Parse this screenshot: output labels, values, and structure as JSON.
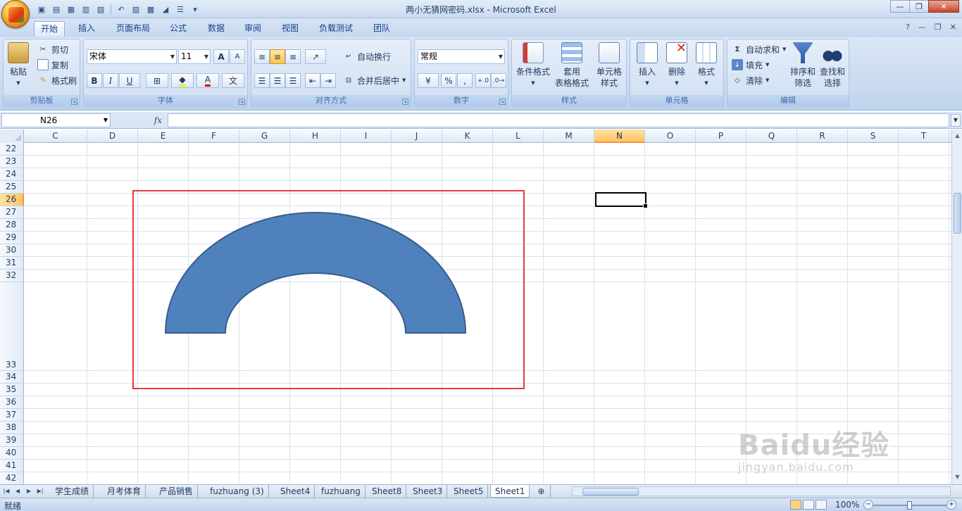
{
  "window": {
    "title": "两小无猜网密码.xlsx - Microsoft Excel",
    "controls": {
      "minimize": "—",
      "restore": "❐",
      "close": "✕"
    }
  },
  "quick_access": {
    "icons": [
      "save-icon",
      "open-icon",
      "print-icon",
      "table-icon",
      "layout-icon",
      "undo-icon",
      "chart-icon",
      "form-icon",
      "sort-icon",
      "qat-customize-icon"
    ]
  },
  "tabs": [
    {
      "label": "开始",
      "active": true
    },
    {
      "label": "插入"
    },
    {
      "label": "页面布局"
    },
    {
      "label": "公式"
    },
    {
      "label": "数据"
    },
    {
      "label": "审阅"
    },
    {
      "label": "视图"
    },
    {
      "label": "负载测试"
    },
    {
      "label": "团队"
    }
  ],
  "ribbon": {
    "clipboard": {
      "paste": "粘贴",
      "cut": "剪切",
      "copy": "复制",
      "format_painter": "格式刷",
      "group": "剪贴板"
    },
    "font": {
      "name": "宋体",
      "size": "11",
      "bold": "B",
      "italic": "I",
      "underline": "U",
      "group": "字体",
      "grow": "A",
      "shrink": "A",
      "color_letter": "A",
      "wen": "文"
    },
    "alignment": {
      "wrap": "自动换行",
      "merge": "合并后居中",
      "group": "对齐方式"
    },
    "number": {
      "format": "常规",
      "percent": "%",
      "comma": ",",
      "group": "数字",
      "dec_inc": "+.0",
      "dec_dec": ".0→"
    },
    "styles": {
      "conditional": "条件格式",
      "table_style": [
        "套用",
        "表格格式"
      ],
      "cell_style": [
        "单元格",
        "样式"
      ],
      "group": "样式"
    },
    "cells": {
      "insert": "插入",
      "delete": "删除",
      "format": "格式",
      "group": "单元格"
    },
    "editing": {
      "autosum": "自动求和",
      "fill": "填充",
      "clear": "清除",
      "sort": [
        "排序和",
        "筛选"
      ],
      "find": [
        "查找和",
        "选择"
      ],
      "group": "编辑",
      "sigma": "Σ"
    }
  },
  "formula_bar": {
    "name_box": "N26",
    "fx": "fx",
    "value": ""
  },
  "columns": [
    "C",
    "D",
    "E",
    "F",
    "G",
    "H",
    "I",
    "J",
    "K",
    "L",
    "M",
    "N",
    "O",
    "P",
    "Q",
    "R",
    "S",
    "T"
  ],
  "selected_column": "N",
  "rows": [
    "22",
    "23",
    "24",
    "25",
    "26",
    "27",
    "28",
    "29",
    "30",
    "31",
    "32",
    "33",
    "34",
    "35",
    "36",
    "37",
    "38",
    "39",
    "40",
    "41",
    "42"
  ],
  "selected_row": "26",
  "shape": {
    "type": "block-arc",
    "fill": "#4f81bd",
    "stroke": "#385d8a"
  },
  "highlight_box_color": "#e8393f",
  "sheets": [
    {
      "label": "学生成绩"
    },
    {
      "label": "月考体育"
    },
    {
      "label": "产品销售"
    },
    {
      "label": "fuzhuang (3)"
    },
    {
      "label": "Sheet4"
    },
    {
      "label": "fuzhuang"
    },
    {
      "label": "Sheet8"
    },
    {
      "label": "Sheet3"
    },
    {
      "label": "Sheet5"
    },
    {
      "label": "Sheet1",
      "active": true
    }
  ],
  "status": {
    "mode": "就绪",
    "zoom": "100%"
  },
  "watermark": {
    "main": "Baidu经验",
    "sub": "jingyan.baidu.com"
  }
}
